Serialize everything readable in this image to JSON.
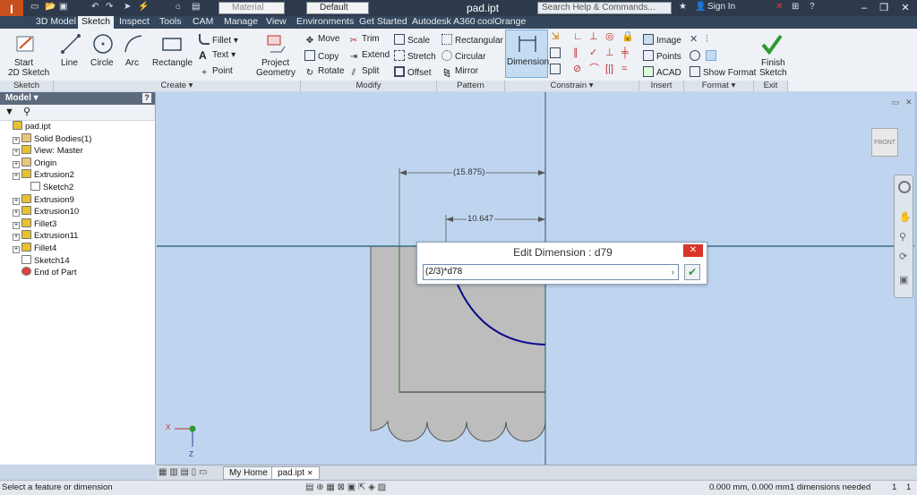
{
  "titlebar": {
    "material_placeholder": "Material",
    "appearance_value": "Default",
    "document_title": "pad.ipt",
    "search_placeholder": "Search Help & Commands...",
    "sign_in": "Sign In"
  },
  "tabs": [
    "3D Model",
    "Sketch",
    "Inspect",
    "Tools",
    "CAM",
    "Manage",
    "View",
    "Environments",
    "Get Started",
    "Autodesk A360",
    "coolOrange"
  ],
  "active_tab": "Sketch",
  "ribbon": {
    "sketch": {
      "start_line1": "Start",
      "start_line2": "2D Sketch",
      "group": "Sketch"
    },
    "create": {
      "line": "Line",
      "circle": "Circle",
      "arc": "Arc",
      "rectangle": "Rectangle",
      "fillet": "Fillet",
      "text": "Text",
      "point": "Point",
      "project_line1": "Project",
      "project_line2": "Geometry",
      "group": "Create"
    },
    "modify": {
      "move": "Move",
      "copy": "Copy",
      "rotate": "Rotate",
      "trim": "Trim",
      "extend": "Extend",
      "split": "Split",
      "scale": "Scale",
      "stretch": "Stretch",
      "offset": "Offset",
      "group": "Modify"
    },
    "pattern": {
      "rectangular": "Rectangular",
      "circular": "Circular",
      "mirror": "Mirror",
      "group": "Pattern"
    },
    "constrain": {
      "dimension": "Dimension",
      "group": "Constrain"
    },
    "insert": {
      "image": "Image",
      "points": "Points",
      "acad": "ACAD",
      "group": "Insert"
    },
    "format": {
      "show_format": "Show Format",
      "group": "Format"
    },
    "exit": {
      "finish_line1": "Finish",
      "finish_line2": "Sketch",
      "group": "Exit"
    }
  },
  "browser": {
    "title": "Model",
    "items": [
      {
        "label": "pad.ipt",
        "indent": 0,
        "icon": "part-icon"
      },
      {
        "label": "Solid Bodies(1)",
        "indent": 1,
        "icon": "folder-icon"
      },
      {
        "label": "View: Master",
        "indent": 1,
        "icon": "view-icon"
      },
      {
        "label": "Origin",
        "indent": 1,
        "icon": "folder-icon"
      },
      {
        "label": "Extrusion2",
        "indent": 1,
        "icon": "extrusion-icon"
      },
      {
        "label": "Sketch2",
        "indent": 2,
        "icon": "sketch-icon"
      },
      {
        "label": "Extrusion9",
        "indent": 1,
        "icon": "extrusion-icon"
      },
      {
        "label": "Extrusion10",
        "indent": 1,
        "icon": "extrusion-icon"
      },
      {
        "label": "Fillet3",
        "indent": 1,
        "icon": "fillet-icon"
      },
      {
        "label": "Extrusion11",
        "indent": 1,
        "icon": "extrusion-icon"
      },
      {
        "label": "Fillet4",
        "indent": 1,
        "icon": "fillet-icon"
      },
      {
        "label": "Sketch14",
        "indent": 1,
        "icon": "sketch-icon"
      },
      {
        "label": "End of Part",
        "indent": 1,
        "icon": "end-of-part-icon"
      }
    ]
  },
  "canvas": {
    "dim_outer": "(15.875)",
    "dim_inner": "10.647",
    "viewcube_label": "FRONT",
    "axis_x": "X",
    "axis_z": "Z"
  },
  "dialog": {
    "title": "Edit Dimension : d79",
    "value": "(2/3)*d78"
  },
  "doc_tabs": {
    "home": "My Home",
    "part": "pad.ipt"
  },
  "status": {
    "prompt": "Select a feature or dimension",
    "coordinates": "0.000 mm, 0.000 mm",
    "dims_needed": "1 dimensions needed",
    "count_a": "1",
    "count_b": "1"
  },
  "colors": {
    "accent": "#3c79c4",
    "canvas_bg": "#bfd5ef",
    "dialog_close": "#d9352a",
    "sketch_line": "#0a0a8a"
  }
}
